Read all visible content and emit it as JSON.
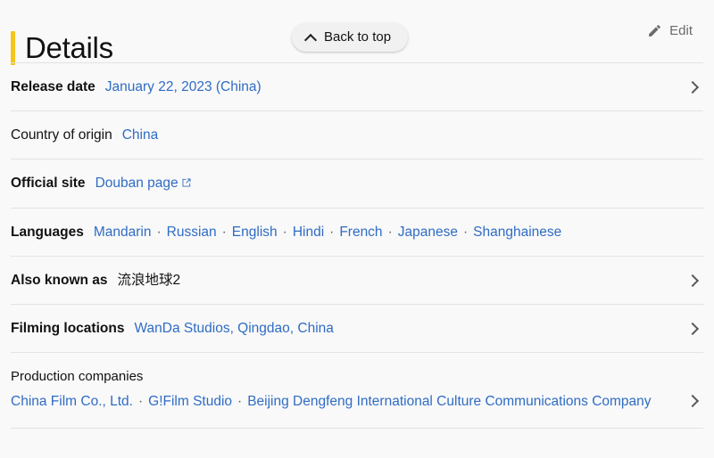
{
  "header": {
    "title": "Details",
    "back_to_top_label": "Back to top",
    "edit_label": "Edit",
    "chevron_up_icon": "chevron-up-icon",
    "pencil_icon": "pencil-icon",
    "accent_color": "#f5c518",
    "link_color": "#2f6cc4"
  },
  "details": [
    {
      "label": "Release date",
      "layout": "inline",
      "bold_label": true,
      "chevron": true,
      "values": [
        {
          "text": "January 22, 2023 (China)",
          "type": "link"
        }
      ]
    },
    {
      "label": "Country of origin",
      "layout": "inline",
      "bold_label": false,
      "chevron": false,
      "values": [
        {
          "text": "China",
          "type": "link"
        }
      ]
    },
    {
      "label": "Official site",
      "layout": "inline",
      "bold_label": true,
      "chevron": false,
      "values": [
        {
          "text": "Douban page",
          "type": "link",
          "external": true
        }
      ]
    },
    {
      "label": "Languages",
      "layout": "inline",
      "bold_label": true,
      "chevron": false,
      "separator": "·",
      "values": [
        {
          "text": "Mandarin",
          "type": "link"
        },
        {
          "text": "Russian",
          "type": "link"
        },
        {
          "text": "English",
          "type": "link"
        },
        {
          "text": "Hindi",
          "type": "link"
        },
        {
          "text": "French",
          "type": "link"
        },
        {
          "text": "Japanese",
          "type": "link"
        },
        {
          "text": "Shanghainese",
          "type": "link"
        }
      ]
    },
    {
      "label": "Also known as",
      "layout": "inline",
      "bold_label": true,
      "chevron": true,
      "values": [
        {
          "text": "流浪地球2",
          "type": "plain"
        }
      ]
    },
    {
      "label": "Filming locations",
      "layout": "inline",
      "bold_label": true,
      "chevron": true,
      "values": [
        {
          "text": "WanDa Studios, Qingdao, China",
          "type": "link"
        }
      ]
    },
    {
      "label": "Production companies",
      "layout": "stacked",
      "bold_label": false,
      "chevron": true,
      "separator": "·",
      "values": [
        {
          "text": "China Film Co., Ltd.",
          "type": "link"
        },
        {
          "text": "G!Film Studio",
          "type": "link"
        },
        {
          "text": "Beijing Dengfeng International Culture Communications Company",
          "type": "link"
        }
      ]
    }
  ]
}
